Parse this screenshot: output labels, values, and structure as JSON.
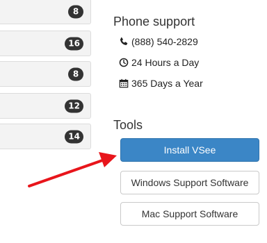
{
  "categories": [
    {
      "count": "8"
    },
    {
      "count": "16"
    },
    {
      "count": "8"
    },
    {
      "count": "12"
    },
    {
      "count": "14"
    }
  ],
  "phone_support": {
    "title": "Phone support",
    "phone": "(888) 540-2829",
    "hours": "24 Hours a Day",
    "days": "365 Days a Year",
    "icons": [
      "phone-icon",
      "clock-icon",
      "calendar-icon"
    ]
  },
  "tools": {
    "title": "Tools",
    "install_label": "Install VSee",
    "windows_label": "Windows Support Software",
    "mac_label": "Mac Support Software"
  },
  "colors": {
    "primary_button": "#3b86c6",
    "badge": "#333333",
    "annotation_arrow": "#e8151b"
  }
}
